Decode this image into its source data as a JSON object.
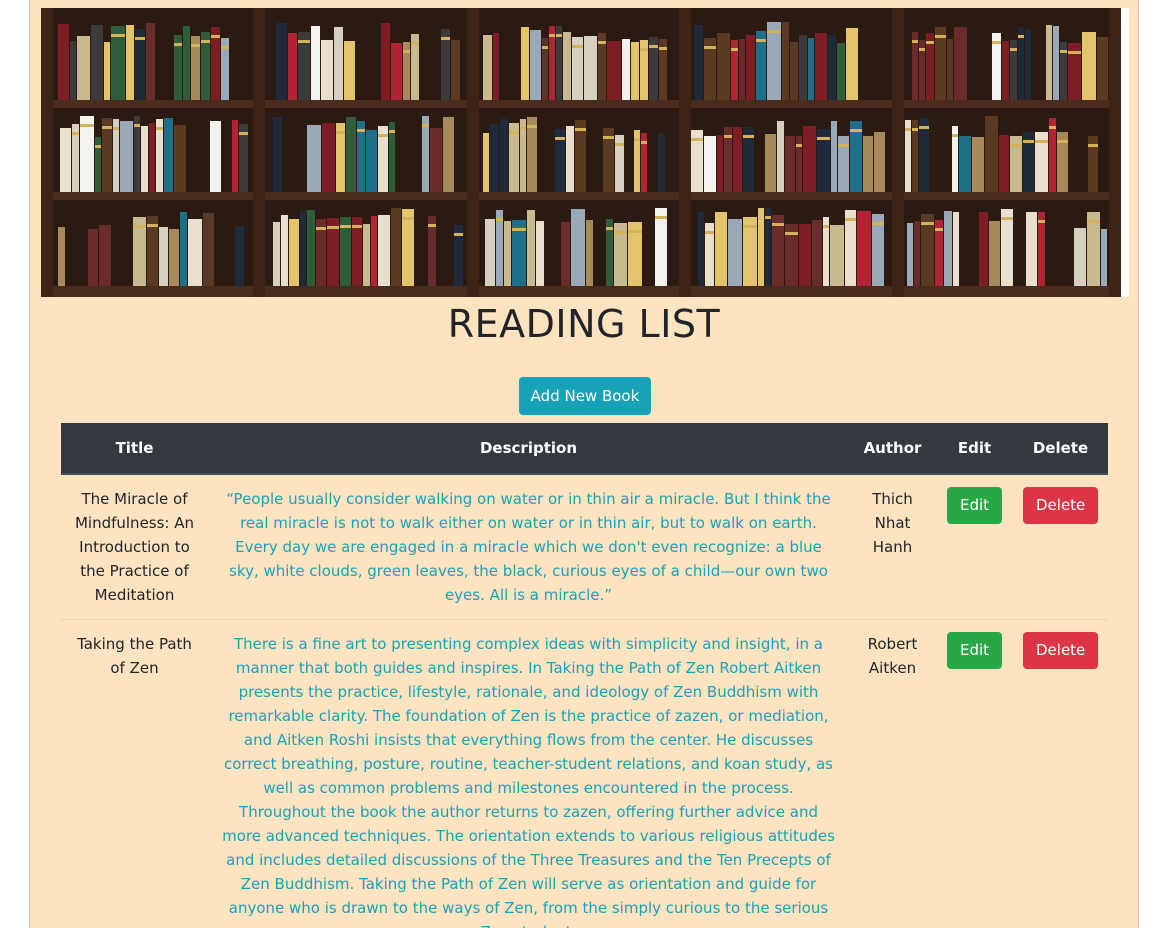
{
  "banner": {
    "image": "bookshelf-photo"
  },
  "page": {
    "title": "READING LIST",
    "add_button_label": "Add New Book"
  },
  "colors": {
    "background": "#fde3c0",
    "header_bg": "#343a40",
    "info": "#17a2b8",
    "success": "#28a745",
    "danger": "#dc3545"
  },
  "table": {
    "headers": {
      "title": "Title",
      "description": "Description",
      "author": "Author",
      "edit": "Edit",
      "delete": "Delete"
    },
    "rows": [
      {
        "title": "The Miracle of Mindfulness: An Introduction to the Practice of Meditation",
        "description": "“People usually consider walking on water or in thin air a miracle. But I think the real miracle is not to walk either on water or in thin air, but to walk on earth. Every day we are engaged in a miracle which we don't even recognize: a blue sky, white clouds, green leaves, the black, curious eyes of a child—our own two eyes. All is a miracle.”",
        "author": "Thich Nhat Hanh",
        "edit_label": "Edit",
        "delete_label": "Delete"
      },
      {
        "title": "Taking the Path of Zen",
        "description": "There is a fine art to presenting complex ideas with simplicity and insight, in a manner that both guides and inspires. In Taking the Path of Zen Robert Aitken presents the practice, lifestyle, rationale, and ideology of Zen Buddhism with remarkable clarity. The foundation of Zen is the practice of zazen, or mediation, and Aitken Roshi insists that everything flows from the center. He discusses correct breathing, posture, routine, teacher-student relations, and koan study, as well as common problems and milestones encountered in the process. Throughout the book the author returns to zazen, offering further advice and more advanced techniques. The orientation extends to various religious attitudes and includes detailed discussions of the Three Treasures and the Ten Precepts of Zen Buddhism. Taking the Path of Zen will serve as orientation and guide for anyone who is drawn to the ways of Zen, from the simply curious to the serious Zen student.",
        "author": "Robert Aitken",
        "edit_label": "Edit",
        "delete_label": "Delete"
      }
    ]
  }
}
